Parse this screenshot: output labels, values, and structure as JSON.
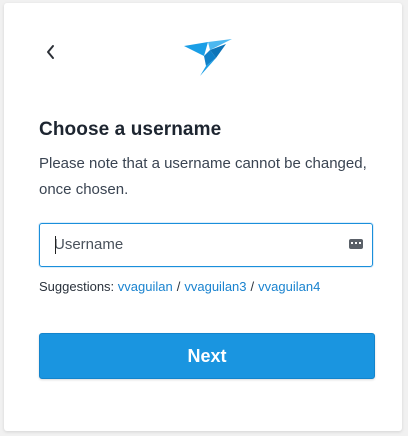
{
  "header": {
    "back_icon": "chevron-left-icon",
    "logo_icon": "hummingbird-logo-icon",
    "logo_color": "#1a9ee6"
  },
  "main": {
    "title": "Choose a username",
    "subtitle": "Please note that a username cannot be changed, once chosen."
  },
  "username_field": {
    "value": "",
    "placeholder": "Username",
    "icon": "keyboard-icon",
    "focus_color": "#1a8fdb"
  },
  "suggestions": {
    "label": "Suggestions:",
    "separator": "/",
    "items": [
      "vvaguilan",
      "vvaguilan3",
      "vvaguilan4"
    ],
    "link_color": "#1a83cf"
  },
  "actions": {
    "next_label": "Next",
    "button_color": "#1a95e0"
  }
}
